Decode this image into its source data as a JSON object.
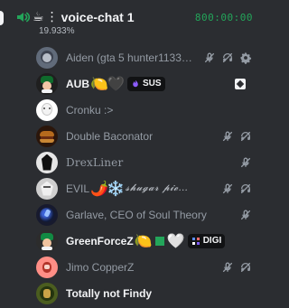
{
  "header": {
    "channel_name": "voice-chat 1",
    "subtitle": "19.933%",
    "timer": "800:00:00"
  },
  "colors": {
    "background": "#2b2d31",
    "text_primary": "#f2f3f5",
    "text_secondary": "#949ba4",
    "timer_green": "#23a55a"
  },
  "members": [
    {
      "name": "Aiden (gta 5 hunter1133…",
      "icons": [
        "muted-mic-icon",
        "deafened-icon",
        "settings-gear-icon"
      ]
    },
    {
      "name": "AUB",
      "tag": "SUS"
    },
    {
      "name": "Cronku :>"
    },
    {
      "name": "Double Baconator",
      "icons": [
        "muted-mic-icon",
        "deafened-icon"
      ]
    },
    {
      "name": "DrexLiner",
      "icons": [
        "muted-mic-icon"
      ]
    },
    {
      "name": "EVIL",
      "fancy": "𝓼𝓱𝓾𝓰𝓪𝓻 𝓹𝓲𝓮…",
      "icons": [
        "muted-mic-icon",
        "deafened-icon"
      ]
    },
    {
      "name": "Garlave, CEO of Soul Theory",
      "icons": [
        "muted-mic-icon"
      ]
    },
    {
      "name": "GreenForceZ",
      "tag": "DIGI"
    },
    {
      "name": "Jimo CopperZ",
      "icons": [
        "muted-mic-icon",
        "deafened-icon"
      ]
    },
    {
      "name": "Totally not Findy"
    }
  ]
}
